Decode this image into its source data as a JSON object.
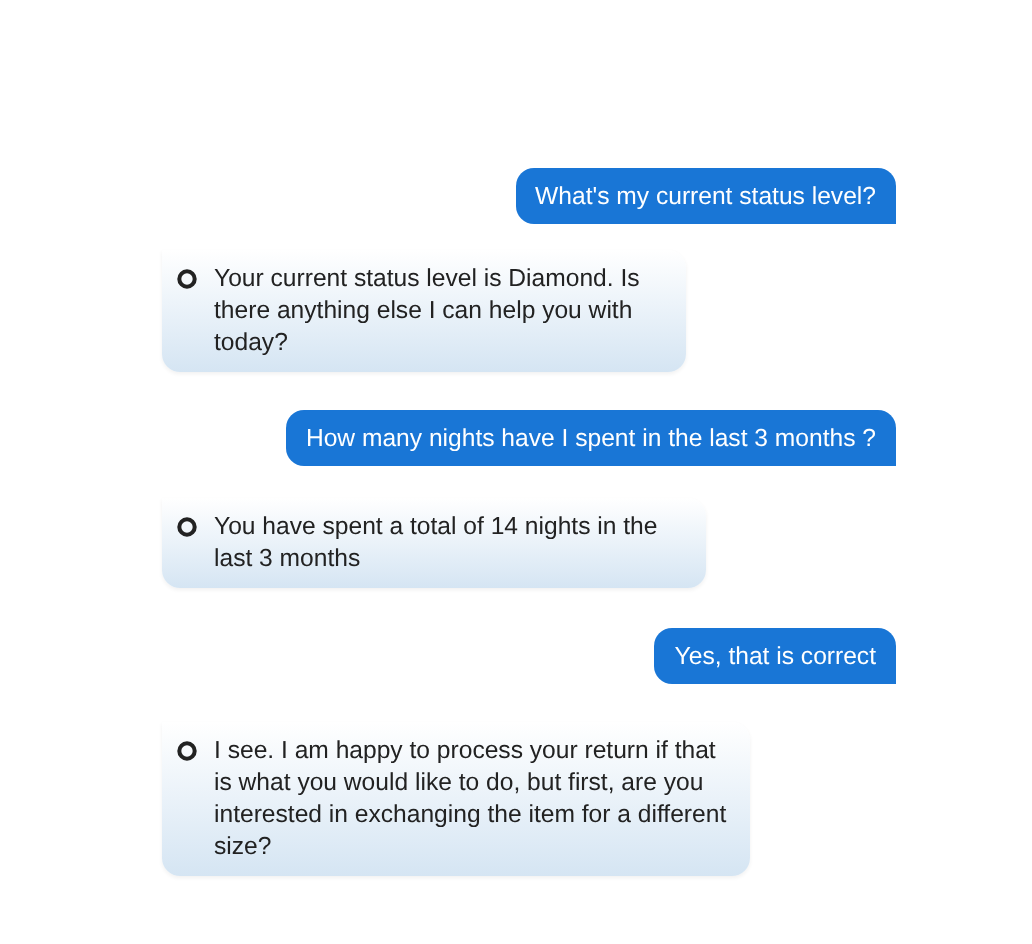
{
  "messages": [
    {
      "kind": "user",
      "text": "What's my current status level?"
    },
    {
      "kind": "bot",
      "text": "Your current status level is Diamond. Is there anything else I can help you with today?"
    },
    {
      "kind": "user",
      "text": "How many nights have I spent in the last 3 months ?"
    },
    {
      "kind": "bot",
      "text": "You have spent a total of 14 nights in the last 3 months"
    },
    {
      "kind": "user",
      "text": "Yes, that is correct"
    },
    {
      "kind": "bot",
      "text": "I see. I am happy to process your return if that is what you would like to do, but first, are you interested in exchanging the item for a different size?"
    }
  ]
}
